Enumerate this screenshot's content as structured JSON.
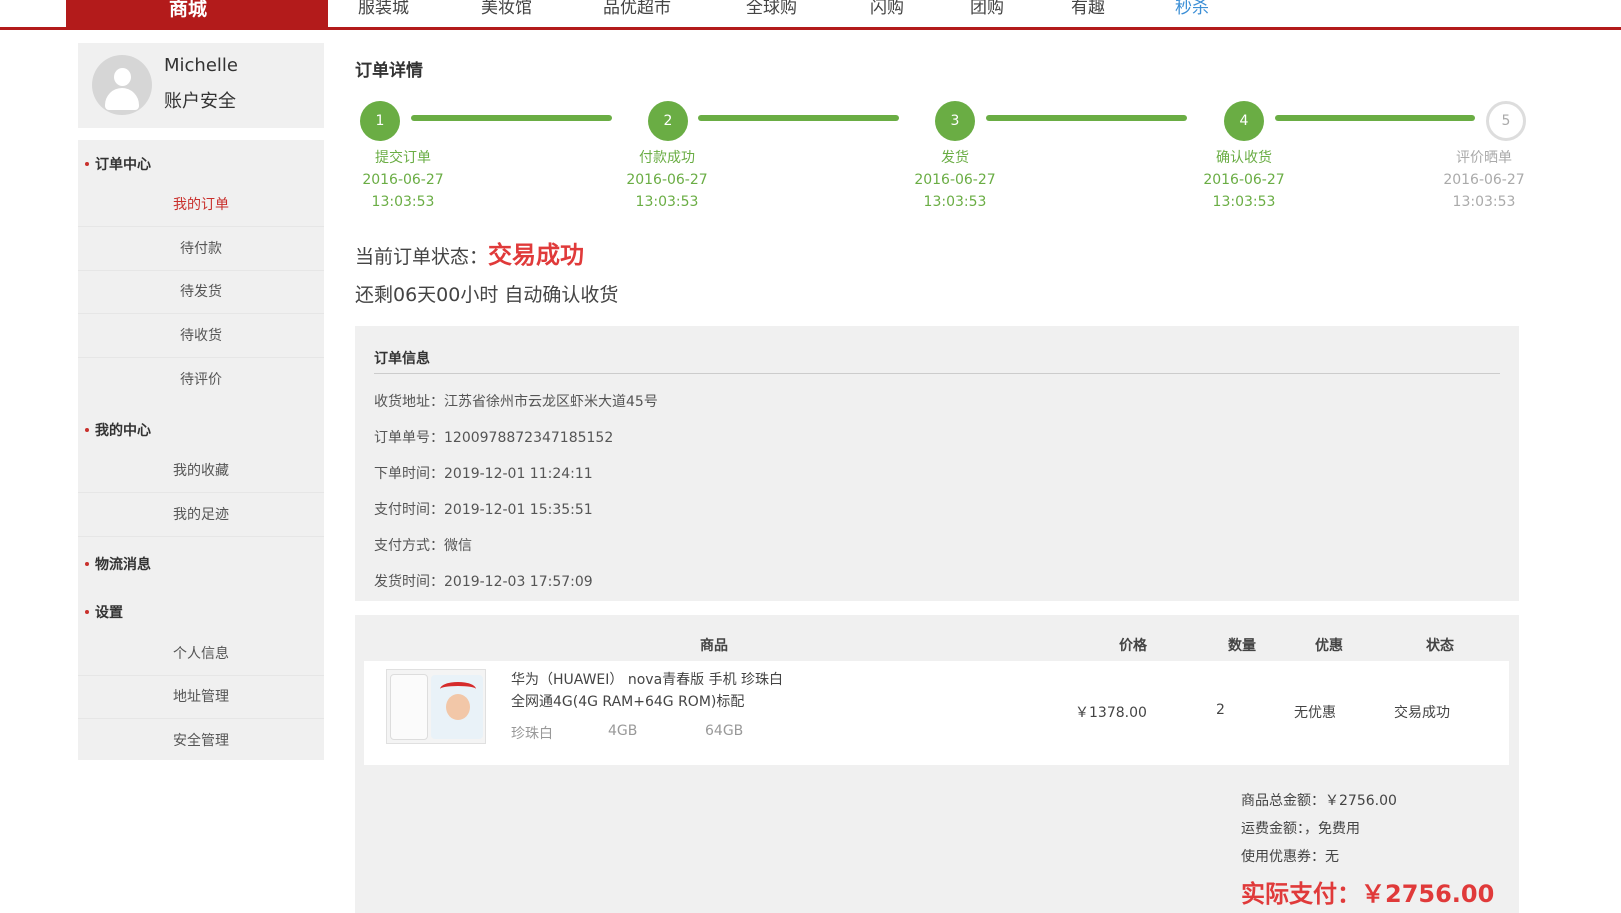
{
  "nav": {
    "brand": "商城",
    "items": [
      "服装城",
      "美妆馆",
      "品优超市",
      "全球购",
      "闪购",
      "团购",
      "有趣",
      "秒杀"
    ]
  },
  "user": {
    "name": "Michelle",
    "account_security": "账户安全"
  },
  "sidebar": {
    "sections": [
      {
        "title": "订单中心",
        "items": [
          "我的订单",
          "待付款",
          "待发货",
          "待收货",
          "待评价"
        ]
      },
      {
        "title": "我的中心",
        "items": [
          "我的收藏",
          "我的足迹"
        ]
      },
      {
        "title": "物流消息",
        "items": []
      },
      {
        "title": "设置",
        "items": [
          "个人信息",
          "地址管理",
          "安全管理"
        ]
      }
    ],
    "active_item": "我的订单"
  },
  "page_title": "订单详情",
  "progress": {
    "steps": [
      {
        "num": "1",
        "label": "提交订单",
        "date": "2016-06-27",
        "time": "13:03:53",
        "done": true
      },
      {
        "num": "2",
        "label": "付款成功",
        "date": "2016-06-27",
        "time": "13:03:53",
        "done": true
      },
      {
        "num": "3",
        "label": "发货",
        "date": "2016-06-27",
        "time": "13:03:53",
        "done": true
      },
      {
        "num": "4",
        "label": "确认收货",
        "date": "2016-06-27",
        "time": "13:03:53",
        "done": true
      },
      {
        "num": "5",
        "label": "评价晒单",
        "date": "2016-06-27",
        "time": "13:03:53",
        "done": false
      }
    ]
  },
  "status": {
    "label": "当前订单状态：",
    "value": "交易成功",
    "countdown": "还剩06天00小时 自动确认收货"
  },
  "order_info": {
    "title": "订单信息",
    "rows": [
      "收货地址：江苏省徐州市云龙区虾米大道45号",
      "订单单号：1200978872347185152",
      "下单时间：2019-12-01 11:24:11",
      "支付时间：2019-12-01 15:35:51",
      "支付方式：微信",
      "发货时间：2019-12-03 17:57:09"
    ]
  },
  "goods_table": {
    "headers": {
      "product": "商品",
      "price": "价格",
      "qty": "数量",
      "discount": "优惠",
      "status": "状态"
    },
    "item": {
      "name_line1": "华为（HUAWEI） nova青春版 手机 珍珠白",
      "name_line2": "全网通4G(4G RAM+64G ROM)标配",
      "color": "珍珠白",
      "ram": "4GB",
      "rom": "64GB",
      "price": "￥1378.00",
      "qty": "2",
      "discount": "无优惠",
      "status": "交易成功"
    }
  },
  "summary": {
    "goods_total": "商品总金额：￥2756.00",
    "shipping": "运费金额：，免费用",
    "coupon": "使用优惠券：无",
    "actual_paid": "实际支付：￥2756.00"
  },
  "colors": {
    "brand_red": "#b31b1b",
    "progress_green": "#6aad44",
    "highlight_red": "#e03a3a",
    "link_blue": "#3c8fd6"
  }
}
